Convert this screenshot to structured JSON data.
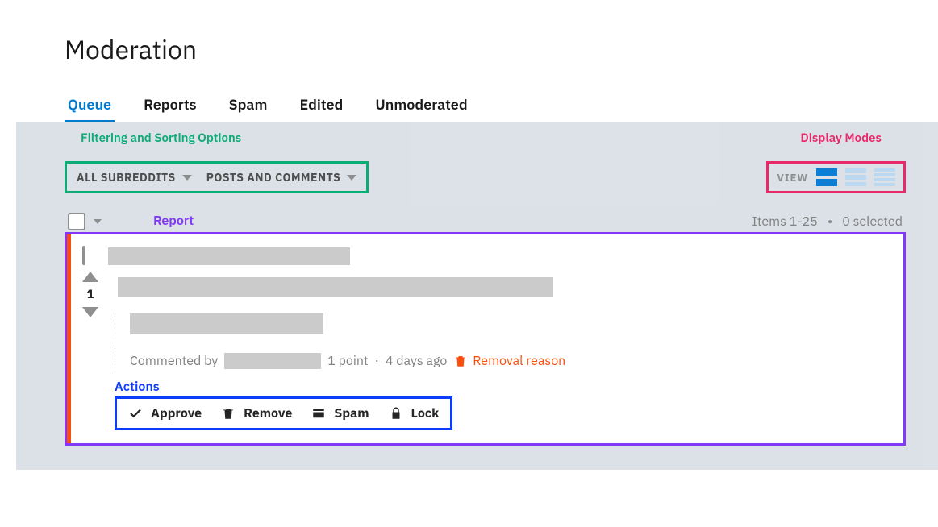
{
  "page": {
    "title": "Moderation"
  },
  "tabs": [
    {
      "label": "Queue",
      "active": true
    },
    {
      "label": "Reports"
    },
    {
      "label": "Spam"
    },
    {
      "label": "Edited"
    },
    {
      "label": "Unmoderated"
    }
  ],
  "annotations": {
    "filter": "Filtering and Sorting Options",
    "display": "Display Modes",
    "report": "Report",
    "actions": "Actions"
  },
  "filters": {
    "subreddits": "ALL SUBREDDITS",
    "content_type": "POSTS AND COMMENTS"
  },
  "view": {
    "label": "VIEW"
  },
  "status": {
    "range": "Items 1-25",
    "selected": "0 selected"
  },
  "report_item": {
    "vote_score": "1",
    "meta": {
      "prefix": "Commented by",
      "points": "1 point",
      "sep": "·",
      "age": "4 days ago",
      "removal": "Removal reason"
    },
    "actions": {
      "approve": "Approve",
      "remove": "Remove",
      "spam": "Spam",
      "lock": "Lock"
    }
  }
}
